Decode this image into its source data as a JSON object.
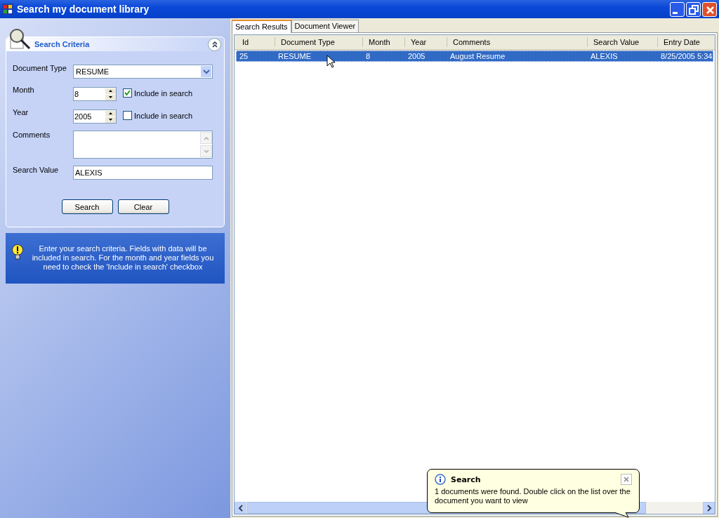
{
  "window": {
    "title": "Search my document library"
  },
  "criteria": {
    "title": "Search Criteria",
    "fields": [
      {
        "kind": "dropdown",
        "label": "Document Type",
        "value": "RESUME"
      },
      {
        "kind": "spinner",
        "label": "Month",
        "value": "8",
        "include_label": "Include in search",
        "checked": true
      },
      {
        "kind": "spinner",
        "label": "Year",
        "value": "2005",
        "include_label": "Include in search",
        "checked": false
      },
      {
        "kind": "textarea",
        "label": "Comments"
      },
      {
        "kind": "text",
        "label": "Search Value",
        "value": "ALEXIS"
      }
    ],
    "buttons": [
      "Search",
      "Clear"
    ]
  },
  "info": {
    "text": "Enter your search criteria. Fields with data will be included in search. For the month and year fields you need to check the 'Include in search' checkbox"
  },
  "tabs": [
    {
      "label": "Search Results",
      "selected": true
    },
    {
      "label": "Document Viewer",
      "selected": false
    }
  ],
  "table": {
    "columns": [
      "Id",
      "Document Type",
      "Month",
      "Year",
      "Comments",
      "Search Value",
      "Entry Date"
    ],
    "rows": [
      {
        "cells": [
          "25",
          "RESUME",
          "8",
          "2005",
          "August Resume",
          "ALEXIS",
          "8/25/2005 5:34"
        ],
        "selected": true
      }
    ]
  },
  "tooltip": {
    "title": "Search",
    "text": "1 documents were found. Double click on the list over the document you want to view"
  }
}
